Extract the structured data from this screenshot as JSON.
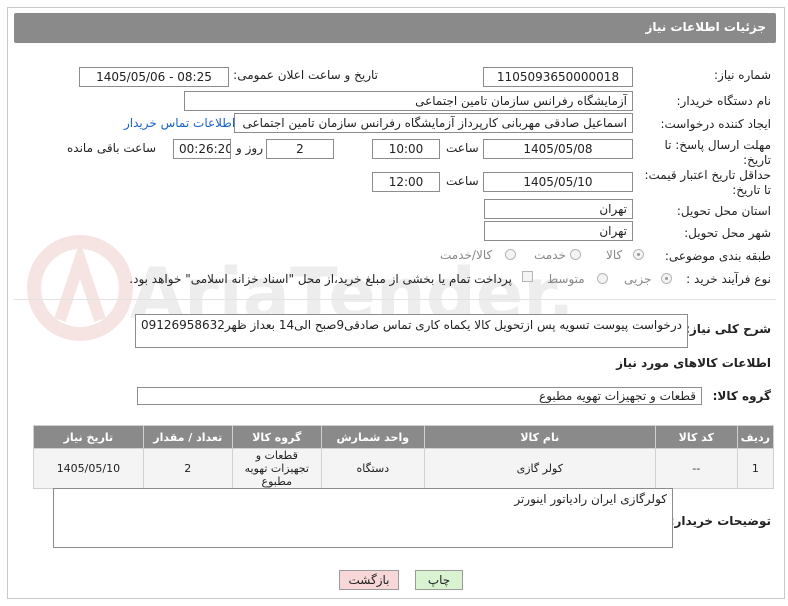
{
  "header": {
    "title": "جزئیات اطلاعات نیاز"
  },
  "fields": {
    "need_number_label": "شماره نیاز:",
    "need_number": "1105093650000018",
    "announce_label": "تاریخ و ساعت اعلان عمومی:",
    "announce_value": "1405/05/06 - 08:25",
    "buyer_org_label": "نام دستگاه خریدار:",
    "buyer_org": "آزمایشگاه رفرانس سازمان تامین اجتماعی",
    "creator_label": "ایجاد کننده درخواست:",
    "creator": "اسماعیل صادقی مهربانی کارپرداز آزمایشگاه رفرانس سازمان تامین اجتماعی",
    "buyer_contact_link": "اطلاعات تماس خریدار",
    "deadline_label": "مهلت ارسال پاسخ: تا تاریخ:",
    "deadline_date": "1405/05/08",
    "time_label": "ساعت",
    "deadline_time": "10:00",
    "days_value": "2",
    "days_label": "روز و",
    "remaining_time": "00:26:20",
    "remaining_label": "ساعت باقی مانده",
    "price_validity_label": "حداقل تاریخ اعتبار قیمت: تا تاریخ:",
    "price_validity_date": "1405/05/10",
    "price_validity_time": "12:00",
    "province_label": "استان محل تحویل:",
    "province": "تهران",
    "city_label": "شهر محل تحویل:",
    "city": "تهران",
    "category_label": "طبقه بندی موضوعی:",
    "category_options": [
      "کالا",
      "خدمت",
      "کالا/خدمت"
    ],
    "process_label": "نوع فرآیند خرید :",
    "process_options": [
      "جزیی",
      "متوسط"
    ],
    "payment_text": "پرداخت تمام یا بخشی از مبلغ خرید،از محل \"اسناد خزانه اسلامی\" خواهد بود."
  },
  "description": {
    "label": "شرح کلی نیاز:",
    "text": "درخواست پیوست تسویه پس ازتحویل کالا یکماه کاری تماس صادقی9صبح الی14 بعداز ظهر09126958632"
  },
  "goods": {
    "section_title": "اطلاعات کالاهای مورد نیاز",
    "group_label": "گروه کالا:",
    "group_value": "قطعات و تجهیزات تهویه مطبوع"
  },
  "table": {
    "headers": [
      "ردیف",
      "کد کالا",
      "نام کالا",
      "واحد شمارش",
      "گروه کالا",
      "تعداد / مقدار",
      "تاریخ نیاز"
    ],
    "rows": [
      [
        "1",
        "--",
        "کولر گازی",
        "دستگاه",
        "قطعات و تجهیزات تهویه مطبوع",
        "2",
        "1405/05/10"
      ]
    ]
  },
  "buyer_notes": {
    "label": "توضیحات خریدار:",
    "text": "کولرگازی ایران رادیاتور اینورتر"
  },
  "buttons": {
    "print": "چاپ",
    "back": "بازگشت"
  },
  "watermark": {
    "text": "AriaTender.net"
  },
  "colors": {
    "header_bg": "#8a8a8a",
    "link": "#1a62c7",
    "print_btn": "#d9f2d0",
    "back_btn": "#f7d7d7"
  }
}
